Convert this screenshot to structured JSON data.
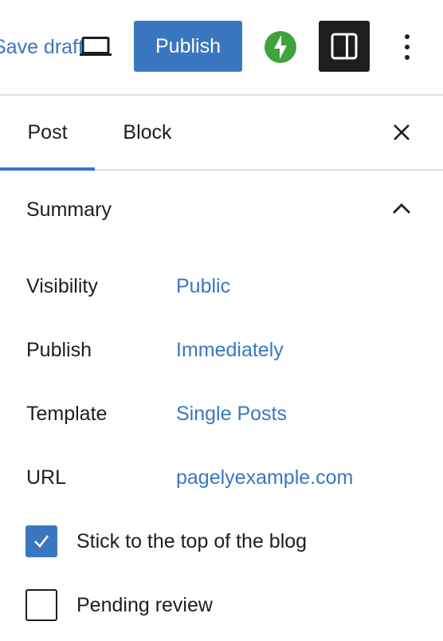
{
  "toolbar": {
    "save_draft_label": "Save draft",
    "publish_label": "Publish",
    "icons": {
      "preview": "laptop-icon",
      "jetpack": "jetpack-bolt-icon",
      "settings": "sidebar-panel-icon",
      "more": "more-vertical-icon"
    }
  },
  "tabs": [
    {
      "label": "Post",
      "active": true
    },
    {
      "label": "Block",
      "active": false
    }
  ],
  "summary": {
    "title": "Summary",
    "rows": [
      {
        "label": "Visibility",
        "value": "Public"
      },
      {
        "label": "Publish",
        "value": "Immediately"
      },
      {
        "label": "Template",
        "value": "Single Posts"
      },
      {
        "label": "URL",
        "value": "pagelyexample.com"
      }
    ],
    "checkboxes": [
      {
        "label": "Stick to the top of the blog",
        "checked": true
      },
      {
        "label": "Pending review",
        "checked": false
      }
    ]
  },
  "colors": {
    "accent": "#3a77c0",
    "text": "#1e1e1e",
    "jetpack_green": "#3ea33b",
    "divider": "#e0e0e0"
  }
}
